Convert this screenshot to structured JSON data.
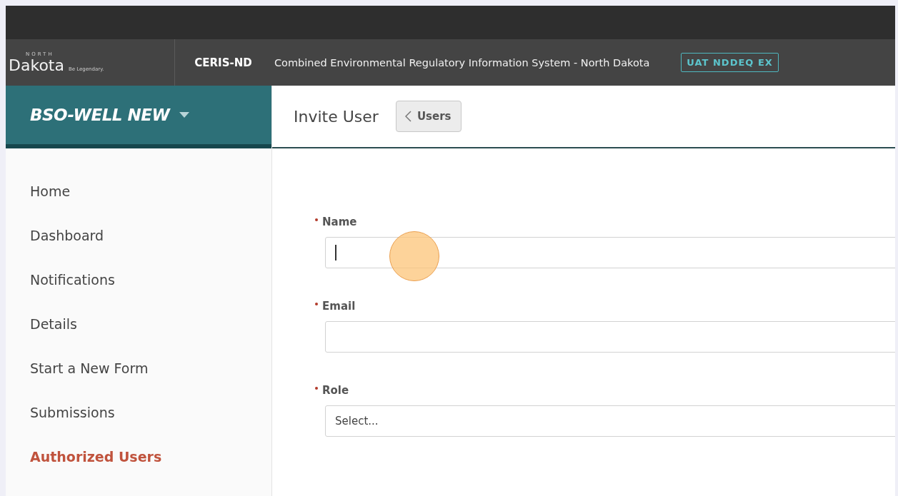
{
  "brand": {
    "logo_small": "NORTH",
    "logo_main": "Dakota",
    "logo_tagline": "Be Legendary.",
    "app_code": "CERIS-ND",
    "app_title": "Combined Environmental Regulatory Information System - North Dakota",
    "env_badge": "UAT NDDEQ EX"
  },
  "sidebar": {
    "title": "BSO-WELL NEW",
    "items": [
      {
        "label": "Home",
        "selected": false
      },
      {
        "label": "Dashboard",
        "selected": false
      },
      {
        "label": "Notifications",
        "selected": false
      },
      {
        "label": "Details",
        "selected": false
      },
      {
        "label": "Start a New Form",
        "selected": false
      },
      {
        "label": "Submissions",
        "selected": false
      },
      {
        "label": "Authorized Users",
        "selected": true
      }
    ]
  },
  "page": {
    "title": "Invite User",
    "back_button": "Users"
  },
  "form": {
    "fields": [
      {
        "kind": "text",
        "label": "Name",
        "required": true,
        "focused": true
      },
      {
        "kind": "text",
        "label": "Email",
        "required": true,
        "focused": false
      },
      {
        "kind": "select",
        "label": "Role",
        "required": true,
        "placeholder": "Select..."
      }
    ]
  }
}
